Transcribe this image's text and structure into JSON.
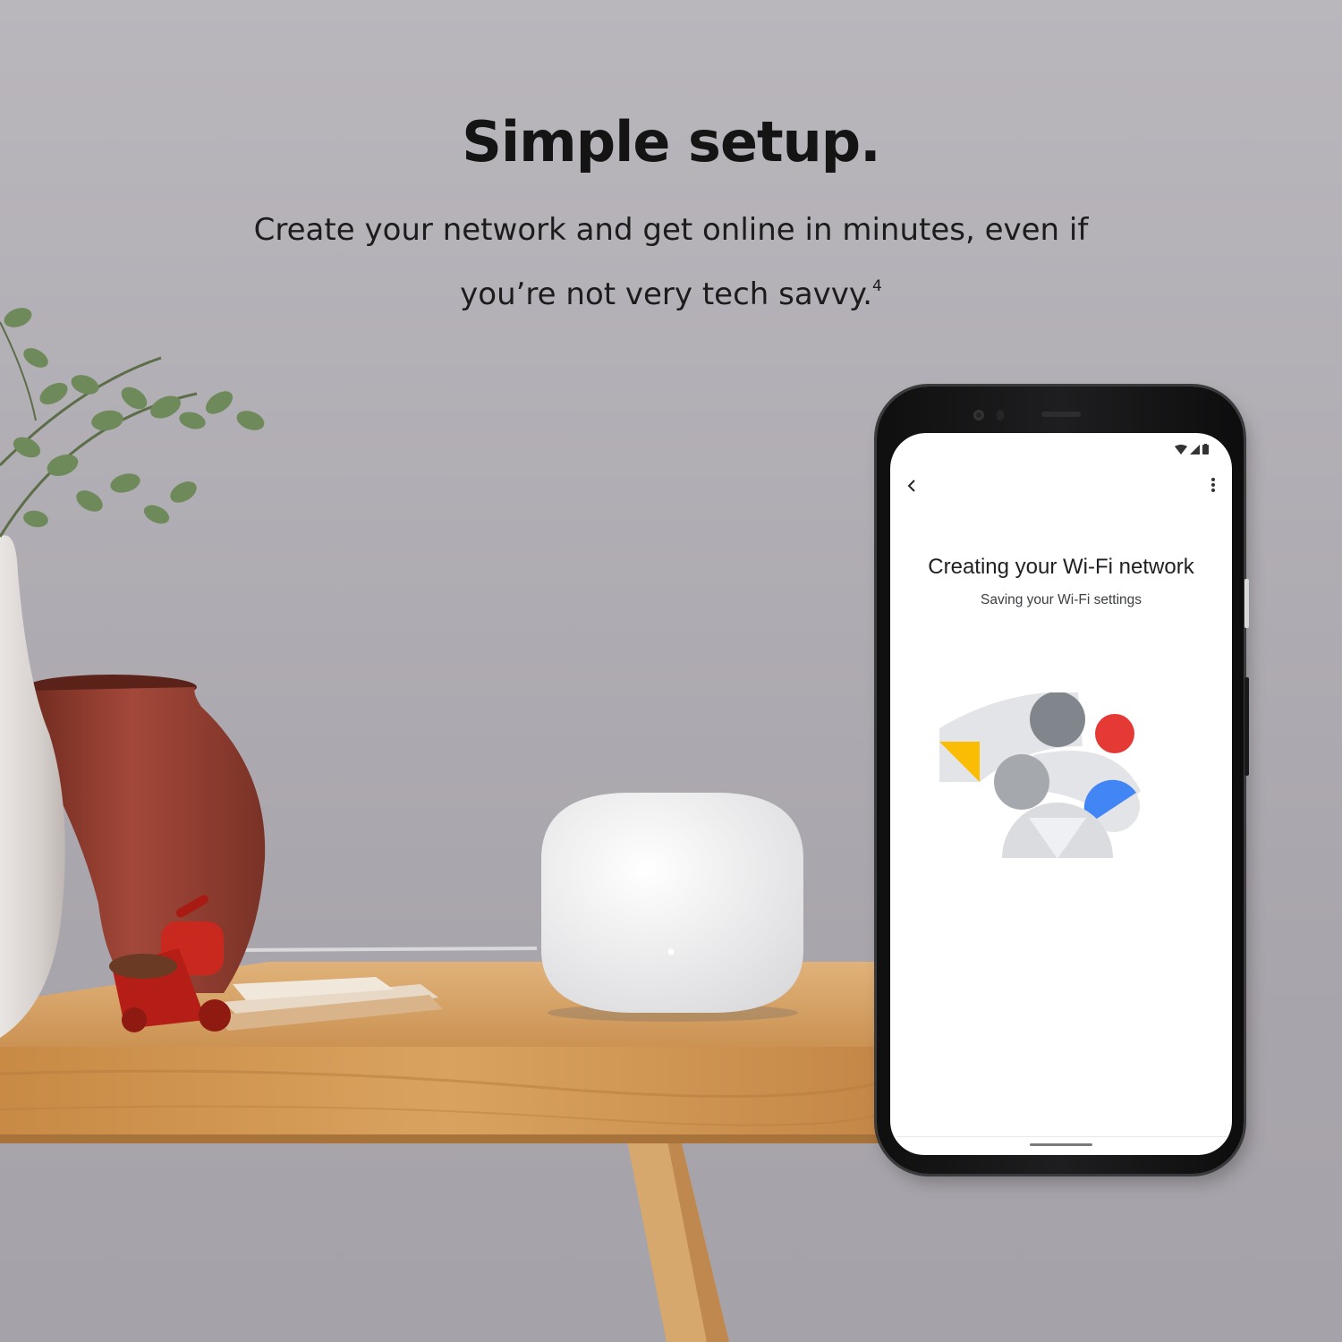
{
  "promo": {
    "headline": "Simple setup.",
    "subtext_line1": "Create your network and get online in minutes, even if",
    "subtext_line2": "you’re not very tech savvy.",
    "footnote_marker": "4"
  },
  "phone_screen": {
    "title": "Creating your Wi-Fi network",
    "subtitle": "Saving your Wi-Fi settings",
    "back_icon": "chevron-left-icon",
    "menu_icon": "more-vert-icon",
    "status_icons": [
      "wifi-icon",
      "signal-icon",
      "battery-icon"
    ]
  },
  "colors": {
    "accent_red": "#e53935",
    "accent_blue": "#4285f4",
    "accent_yellow": "#fbbc04",
    "gray_circle": "#80868b",
    "light_gray_circle": "#a5a9ad",
    "arc_gray": "#e3e4e7"
  }
}
